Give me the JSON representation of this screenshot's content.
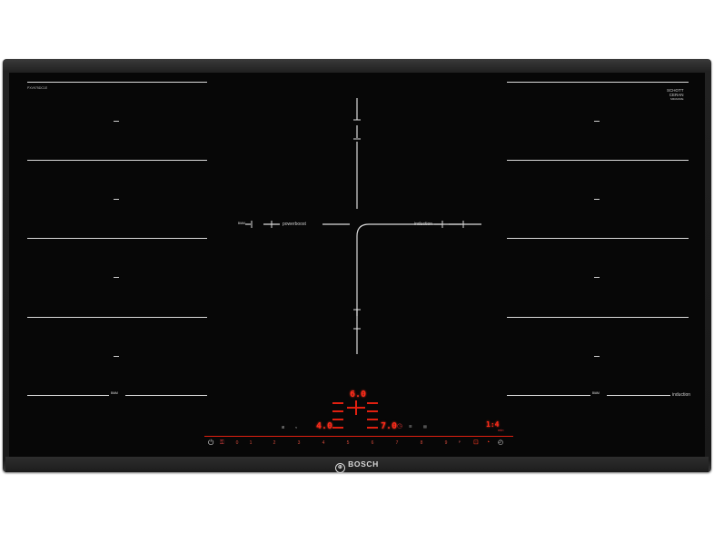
{
  "product": {
    "brand": "BOSCH",
    "model_code": "PXV975DC1E",
    "glass_brand": "SCHOTT\nCERAN",
    "glass_sub": "MIRAFIRE"
  },
  "zones": {
    "left_labels": {
      "flex": "ᴮᴵᴬᴹ",
      "powerboost": "powerboost",
      "flex_bottom": "ᴮᴵᴬᴹ"
    },
    "right_labels": {
      "induction_center": "induction",
      "flex_bottom": "ᴮᴵᴬᴹ",
      "induction_bottom": "induction"
    },
    "dash": "–"
  },
  "display": {
    "top_value": "6.0",
    "left_value": "4.0",
    "center_value": "7.0",
    "timer_value": "1:4",
    "power_scale": [
      "0",
      "1",
      "2",
      "3",
      "4",
      "5",
      "6",
      "7",
      "8",
      "9"
    ]
  },
  "colors": {
    "glass": "#070707",
    "display_red": "#ff2a1a",
    "frame": "#2a2a2a"
  }
}
